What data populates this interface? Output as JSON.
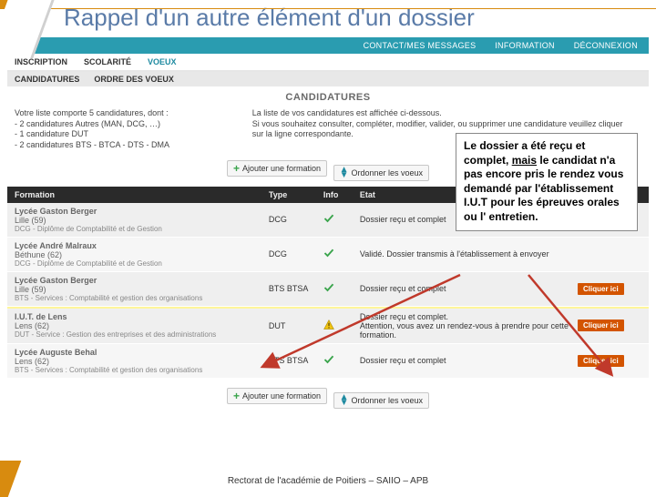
{
  "slide": {
    "title": "Rappel d'un autre élément d'un dossier"
  },
  "topnav": {
    "i1": "CONTACT/MES MESSAGES",
    "i2": "INFORMATION",
    "i3": "DÉCONNEXION"
  },
  "tabs1": {
    "t1": "INSCRIPTION",
    "t2": "SCOLARITÉ",
    "t3": "VOEUX"
  },
  "tabs2": {
    "t1": "CANDIDATURES",
    "t2": "ORDRE DES VOEUX"
  },
  "section": "CANDIDATURES",
  "intro": {
    "col1": "Votre liste comporte 5 candidatures, dont :\n- 2 candidatures Autres (MAN, DCG, …)\n- 1 candidature DUT\n- 2 candidatures BTS - BTCA - DTS - DMA",
    "col2": "La liste de vos candidatures est affichée ci-dessous.\nSi vous souhaitez consulter, compléter, modifier, valider, ou supprimer une candidature veuillez cliquer sur la ligne correspondante."
  },
  "buttons": {
    "add": "Ajouter une formation",
    "order": "Ordonner les voeux"
  },
  "thead": {
    "formation": "Formation",
    "type": "Type",
    "info": "Info",
    "etat": "Etat"
  },
  "rows": [
    {
      "school": "Lycée Gaston Berger",
      "city": "Lille (59)",
      "fname": "DCG - Diplôme de Comptabilité et de Gestion",
      "type": "DCG",
      "etat": "Dossier reçu et complet",
      "ok": true
    },
    {
      "school": "Lycée André Malraux",
      "city": "Béthune (62)",
      "fname": "DCG - Diplôme de Comptabilité et de Gestion",
      "type": "DCG",
      "etat": "Validé. Dossier transmis à l'établissement à envoyer",
      "ok": true
    },
    {
      "school": "Lycée Gaston Berger",
      "city": "Lille (59)",
      "fname": "BTS - Services : Comptabilité et gestion des organisations",
      "type": "BTS BTSA",
      "etat": "Dossier reçu et complet",
      "ok": true,
      "cliquer": "Cliquer ici"
    },
    {
      "school": "I.U.T. de Lens",
      "city": "Lens (62)",
      "fname": "DUT - Service : Gestion des entreprises et des administrations",
      "type": "DUT",
      "etat": "Dossier reçu et complet.\nAttention, vous avez un rendez-vous à prendre pour cette formation.",
      "warn": true,
      "cliquer": "Cliquer ici"
    },
    {
      "school": "Lycée Auguste Behal",
      "city": "Lens (62)",
      "fname": "BTS - Services : Comptabilité et gestion des organisations",
      "type": "BTS BTSA",
      "etat": "Dossier reçu et complet",
      "ok": true,
      "cliquer": "Cliquer ici"
    }
  ],
  "callout": {
    "l1": "Le dossier a été reçu et complet, ",
    "u": "mais",
    "l2": " le candidat n'a pas encore pris le rendez vous demandé par l'établissement I.U.T pour les épreuves orales ou l' entretien."
  },
  "footer": "Rectorat de l'académie de Poitiers – SAIIO – APB"
}
